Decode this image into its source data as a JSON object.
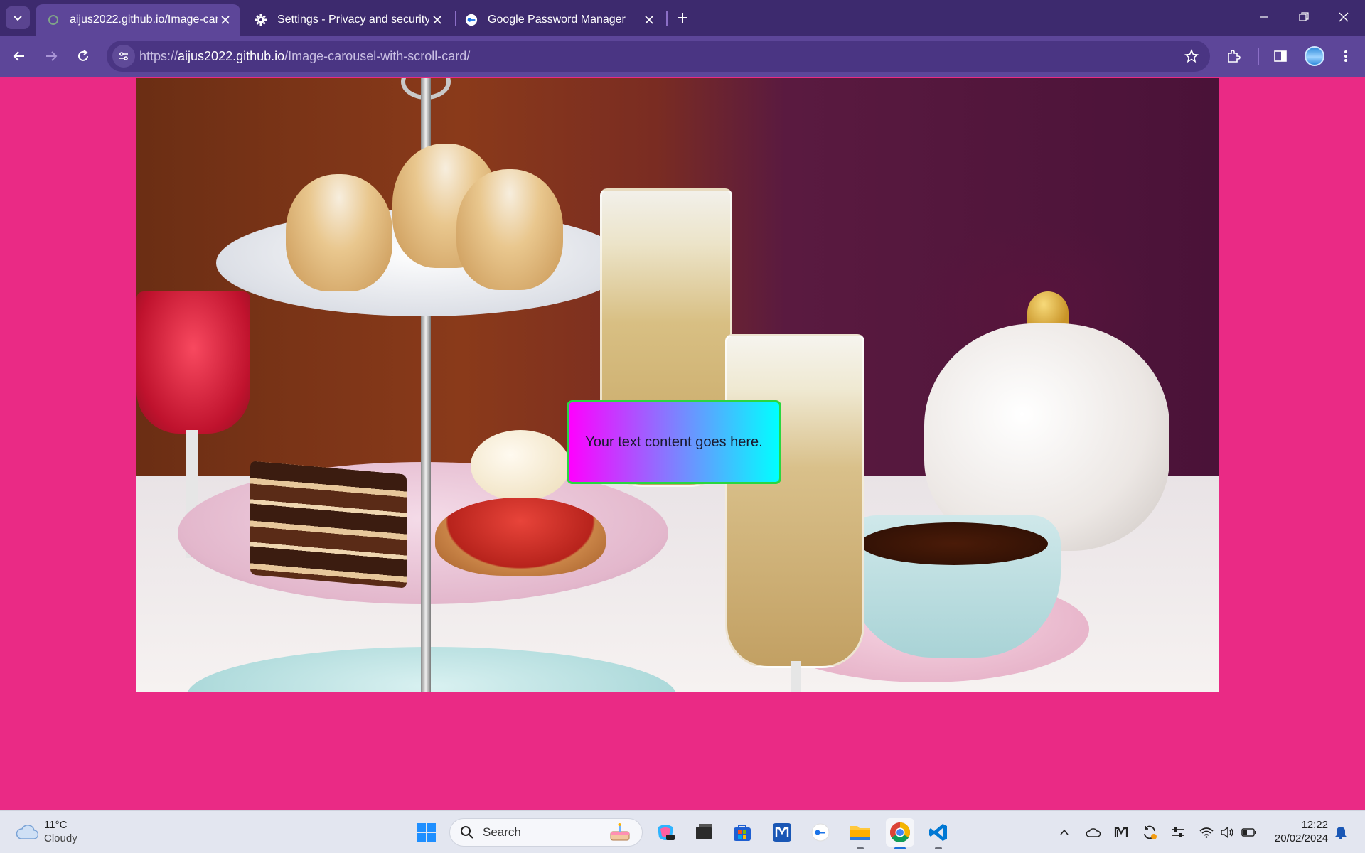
{
  "browser": {
    "tabs": [
      {
        "title": "aijus2022.github.io/Image-caro",
        "active": true
      },
      {
        "title": "Settings - Privacy and security",
        "active": false
      },
      {
        "title": "Google Password Manager",
        "active": false
      }
    ],
    "url_scheme": "https://",
    "url_host": "aijus2022.github.io",
    "url_path": "/Image-carousel-with-scroll-card/"
  },
  "page": {
    "card_text": "Your text content goes here.",
    "background_color": "#ea2a85",
    "card_gradient": [
      "#ff00ff",
      "#00ffff"
    ],
    "card_border_color": "#2ad640"
  },
  "taskbar": {
    "weather_temp": "11°C",
    "weather_condition": "Cloudy",
    "search_label": "Search",
    "time": "12:22",
    "date": "20/02/2024"
  }
}
